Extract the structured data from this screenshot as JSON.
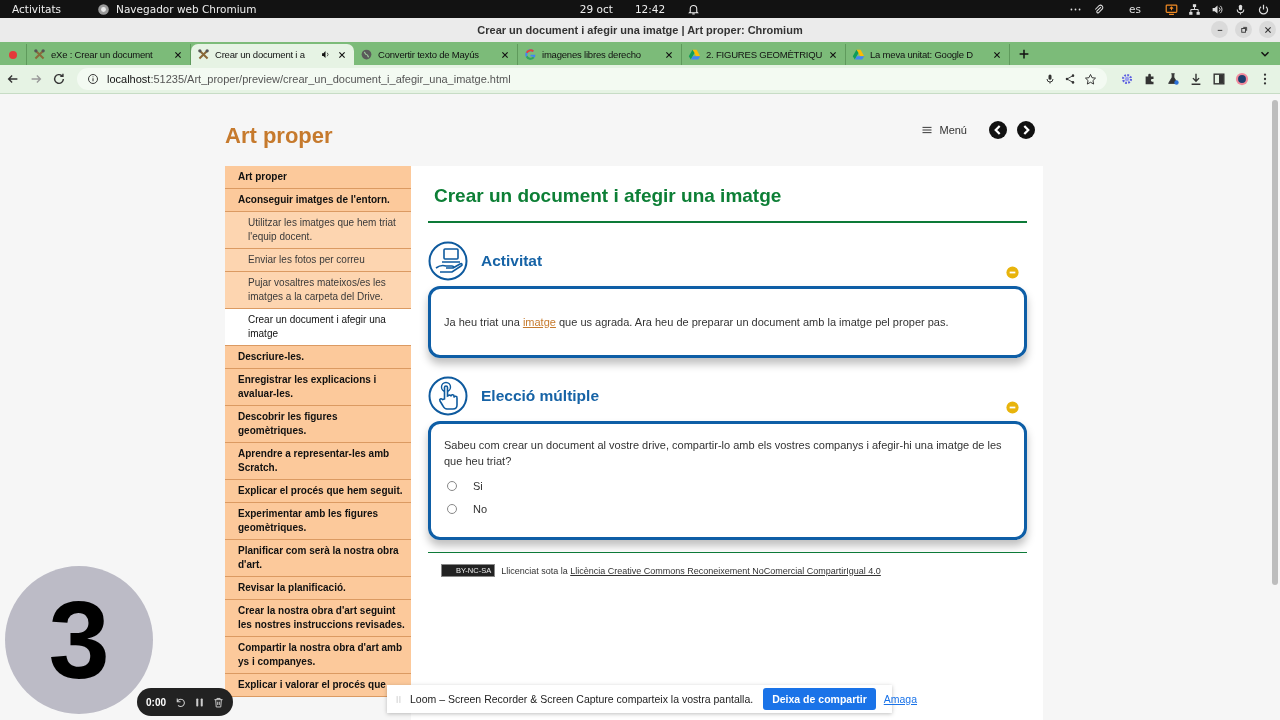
{
  "system_bar": {
    "activities": "Activitats",
    "app": "Navegador web Chromium",
    "date": "29 oct",
    "time": "12:42",
    "language": "es"
  },
  "window": {
    "title": "Crear un document i afegir una imatge | Art proper: Chromium"
  },
  "recording_tab": {
    "recording": true
  },
  "tabs": [
    {
      "title": "eXe : Crear un document",
      "kind": "exe",
      "audio": false,
      "selected": false
    },
    {
      "title": "Crear un document i a",
      "kind": "exe",
      "audio": true,
      "selected": true
    },
    {
      "title": "Convertir texto de Mayús",
      "kind": "globe",
      "audio": false,
      "selected": false
    },
    {
      "title": "imagenes libres derecho",
      "kind": "google",
      "audio": false,
      "selected": false
    },
    {
      "title": "2. FIGURES GEOMÈTRIQU",
      "kind": "drive",
      "audio": false,
      "selected": false
    },
    {
      "title": "La meva unitat: Google D",
      "kind": "drive",
      "audio": false,
      "selected": false
    }
  ],
  "address_bar": {
    "host": "localhost",
    "path": ":51235/Art_proper/preview/crear_un_document_i_afegir_una_imatge.html"
  },
  "site": {
    "title": "Art proper",
    "menu": "Menú"
  },
  "nav": [
    {
      "label": "Art proper",
      "selected": false
    },
    {
      "label": "Aconseguir imatges de l'entorn.",
      "selected": false,
      "children": [
        {
          "label": "Utilitzar les imatges que hem triat l'equip docent.",
          "selected": false
        },
        {
          "label": "Enviar les fotos per correu",
          "selected": false
        },
        {
          "label": "Pujar vosaltres mateixos/es les imatges a la carpeta del Drive.",
          "selected": false
        },
        {
          "label": "Crear un document i afegir una imatge",
          "selected": true
        }
      ]
    },
    {
      "label": "Descriure-les.",
      "selected": false
    },
    {
      "label": "Enregistrar les explicacions i avaluar-les.",
      "selected": false
    },
    {
      "label": "Descobrir les figures geomètriques.",
      "selected": false
    },
    {
      "label": "Aprendre a representar-les amb Scratch.",
      "selected": false
    },
    {
      "label": "Explicar el procés que hem seguit.",
      "selected": false
    },
    {
      "label": "Experimentar amb les figures geomètriques.",
      "selected": false
    },
    {
      "label": "Planificar com serà la nostra obra d'art.",
      "selected": false
    },
    {
      "label": "Revisar la planificació.",
      "selected": false
    },
    {
      "label": "Crear la nostra obra d'art seguint les nostres instruccions revisades.",
      "selected": false
    },
    {
      "label": "Compartir la nostra obra d'art amb",
      "label_continued": "ys i companyes.",
      "selected": false
    },
    {
      "label": "Explicar i valorar el procés que",
      "selected": false
    }
  ],
  "page": {
    "title": "Crear un document i afegir una imatge",
    "sections": [
      {
        "kind": "activity",
        "heading": "Activitat",
        "expanded": true,
        "text_before": "Ja heu triat una ",
        "link": "imatge",
        "text_after": " que us agrada. Ara heu de preparar un document amb la imatge pel proper pas."
      },
      {
        "kind": "multiple_choice",
        "heading": "Elecció múltiple",
        "expanded": true,
        "question": "Sabeu com crear un document al vostre drive, compartir-lo amb els vostres companys i afegir-hi una imatge de les que heu triat?",
        "options": [
          {
            "label": "Si",
            "selected": false
          },
          {
            "label": "No",
            "selected": false
          }
        ]
      }
    ]
  },
  "footer": {
    "badge": "BY-NC-SA",
    "prefix": "Llicenciat sota la",
    "link": "Llicència Creative Commons Reconeixement NoComercial CompartirIgual 4.0"
  },
  "recorder": {
    "camera_label": "3",
    "timer": "0:00"
  },
  "share_bar": {
    "message": "Loom – Screen Recorder & Screen Capture comparteix la vostra pantalla.",
    "stop": "Deixa de compartir",
    "hide": "Amaga"
  }
}
